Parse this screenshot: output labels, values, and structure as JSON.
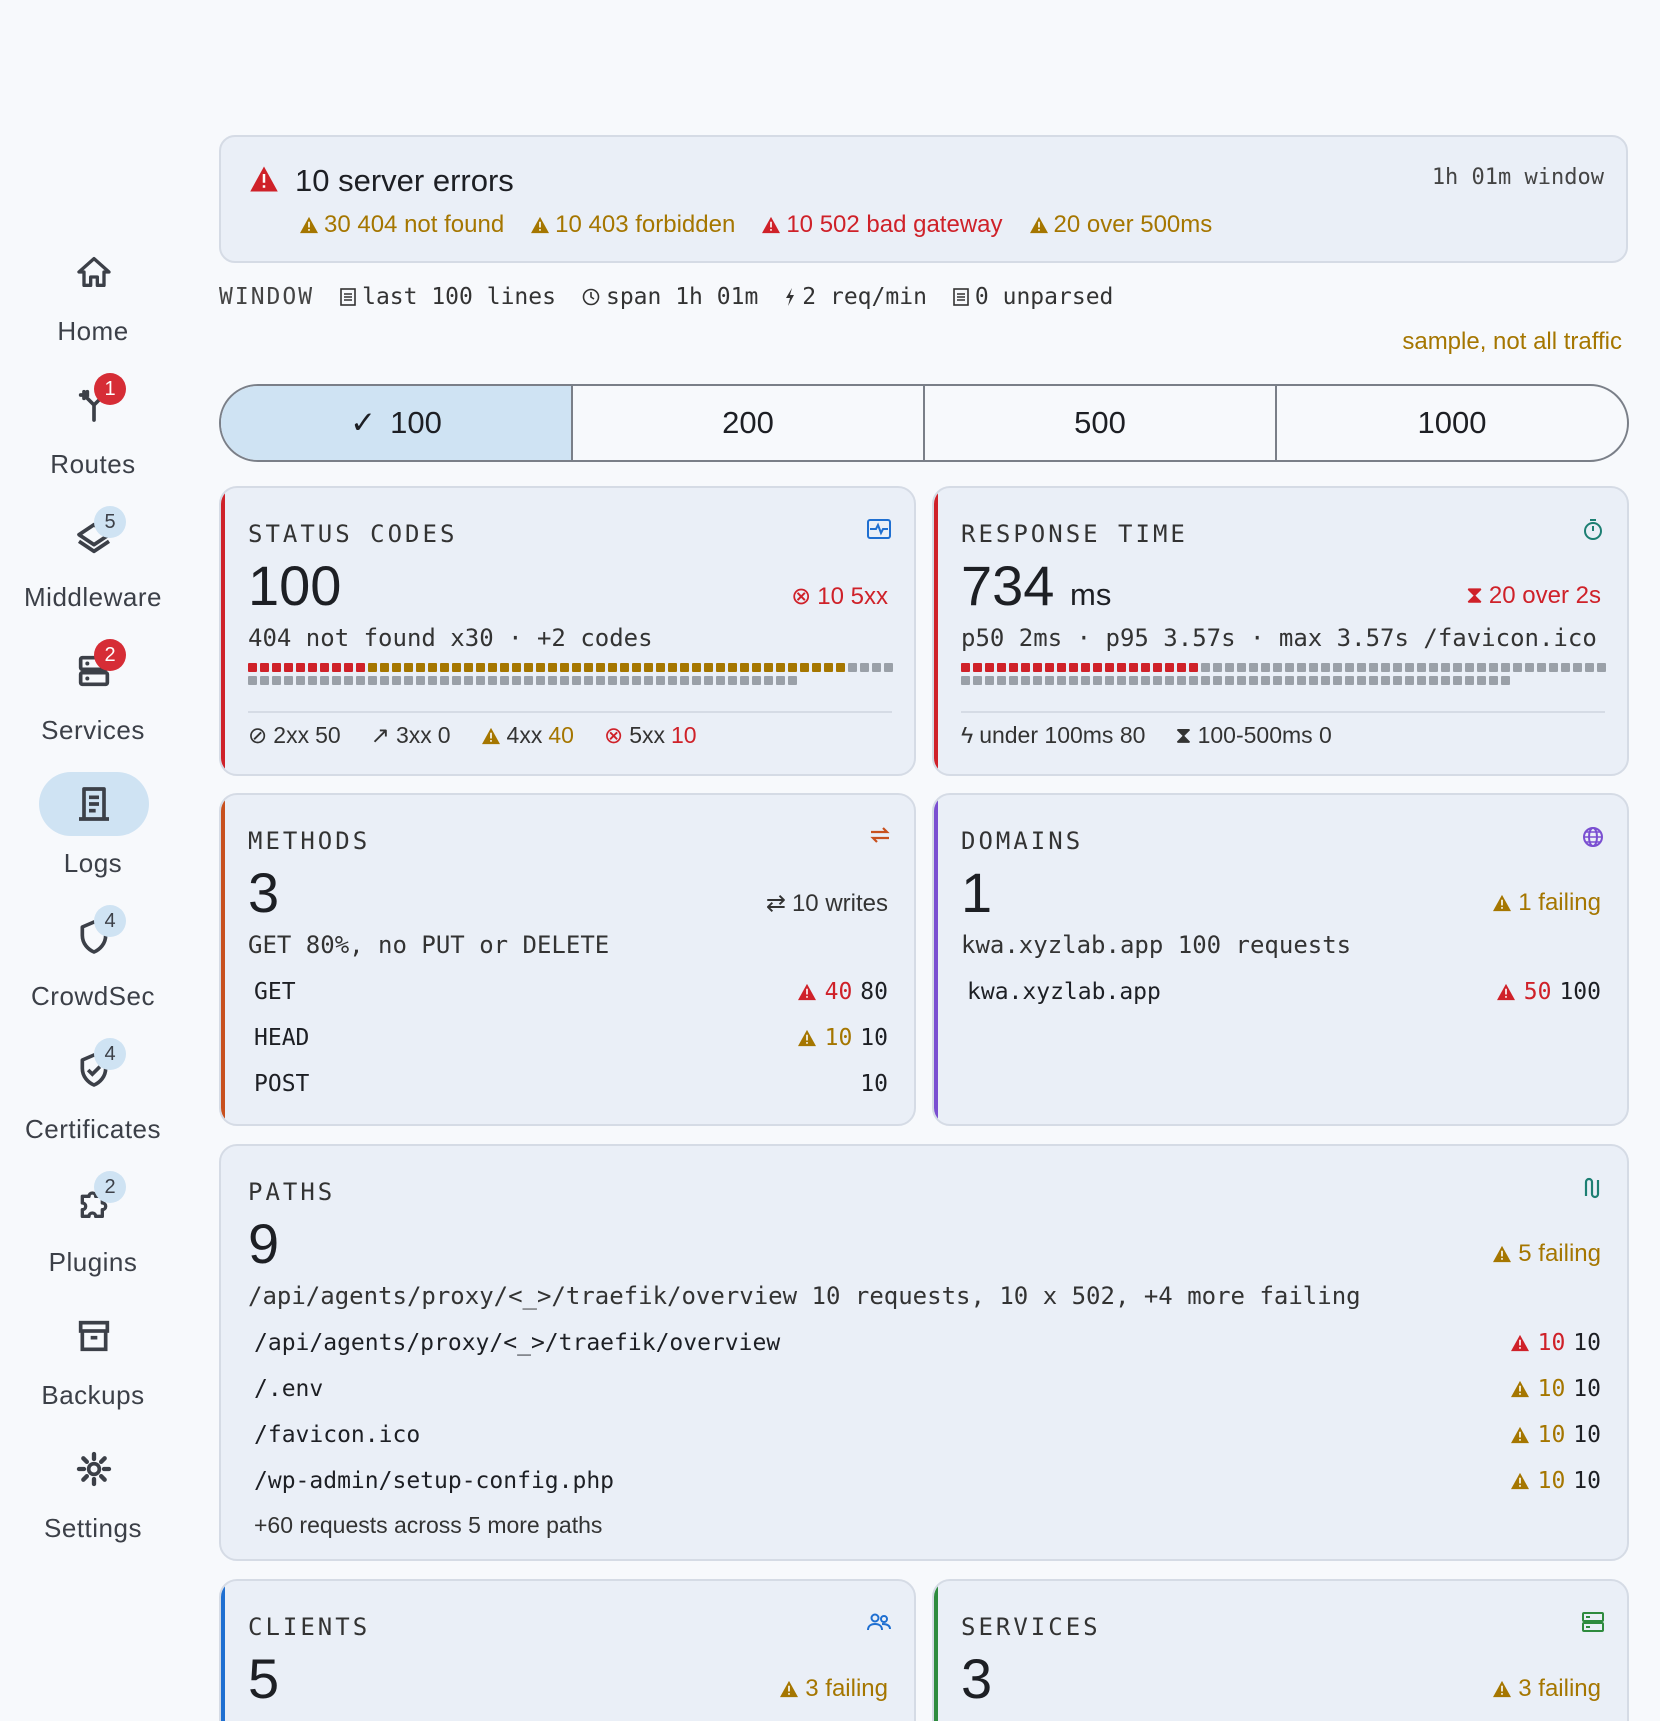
{
  "sidebar": {
    "items": [
      {
        "label": "Home",
        "badge": ""
      },
      {
        "label": "Routes",
        "badge": "1"
      },
      {
        "label": "Middleware",
        "badge": "5"
      },
      {
        "label": "Services",
        "badge": "2"
      },
      {
        "label": "Logs",
        "badge": ""
      },
      {
        "label": "CrowdSec",
        "badge": "4"
      },
      {
        "label": "Certificates",
        "badge": "4"
      },
      {
        "label": "Plugins",
        "badge": "2"
      },
      {
        "label": "Backups",
        "badge": ""
      },
      {
        "label": "Settings",
        "badge": ""
      }
    ]
  },
  "banner": {
    "title": "10 server errors",
    "window": "1h 01m window",
    "items": [
      "30 404 not found",
      "10 403 forbidden",
      "10 502 bad gateway",
      "20 over 500ms"
    ]
  },
  "window_line": {
    "label": "WINDOW",
    "lines": "last 100 lines",
    "span": "span 1h 01m",
    "rate": "2 req/min",
    "unparsed": "0 unparsed",
    "sample_note": "sample, not all traffic"
  },
  "segments": [
    "100",
    "200",
    "500",
    "1000"
  ],
  "status_codes": {
    "title": "STATUS CODES",
    "value": "100",
    "right": "10 5xx",
    "sub": "404 not found x30 · +2 codes",
    "dots": {
      "red": 10,
      "amber": 40,
      "gray": 50
    },
    "legend": {
      "l2xx": "2xx",
      "v2xx": "50",
      "l3xx": "3xx",
      "v3xx": "0",
      "l4xx": "4xx",
      "v4xx": "40",
      "l5xx": "5xx",
      "v5xx": "10"
    }
  },
  "response_time": {
    "title": "RESPONSE TIME",
    "value": "734",
    "unit": "ms",
    "right": "20 over 2s",
    "sub": "p50 2ms · p95 3.57s · max 3.57s /favicon.ico",
    "dots": {
      "red": 20,
      "gray": 80
    },
    "legend": {
      "fast": "under 100ms 80",
      "mid": "100-500ms 0"
    }
  },
  "methods": {
    "title": "METHODS",
    "value": "3",
    "right": "10 writes",
    "sub": "GET 80%, no PUT or DELETE",
    "rows": [
      {
        "name": "GET",
        "fail": "40",
        "total": "80"
      },
      {
        "name": "HEAD",
        "fail": "10",
        "total": "10"
      },
      {
        "name": "POST",
        "fail": "",
        "total": "10"
      }
    ]
  },
  "domains": {
    "title": "DOMAINS",
    "value": "1",
    "right": "1 failing",
    "sub": "kwa.xyzlab.app 100 requests",
    "rows": [
      {
        "name": "kwa.xyzlab.app",
        "fail": "50",
        "total": "100"
      }
    ]
  },
  "paths": {
    "title": "PATHS",
    "value": "9",
    "right": "5 failing",
    "sub": "/api/agents/proxy/<_>/traefik/overview 10 requests, 10 x 502, +4 more failing",
    "rows": [
      {
        "name": "/api/agents/proxy/<_>/traefik/overview",
        "fail": "10",
        "total": "10"
      },
      {
        "name": "/.env",
        "fail": "10",
        "total": "10"
      },
      {
        "name": "/favicon.ico",
        "fail": "10",
        "total": "10"
      },
      {
        "name": "/wp-admin/setup-config.php",
        "fail": "10",
        "total": "10"
      }
    ],
    "more": "+60 requests across 5 more paths"
  },
  "clients": {
    "title": "CLIENTS",
    "value": "5",
    "right": "3 failing"
  },
  "services": {
    "title": "SERVICES",
    "value": "3",
    "right": "3 failing"
  },
  "colors": {
    "red": "#cf2129",
    "amber": "#a57600",
    "blue": "#1f6fd1",
    "accent_blue": "#cfe3f3"
  }
}
